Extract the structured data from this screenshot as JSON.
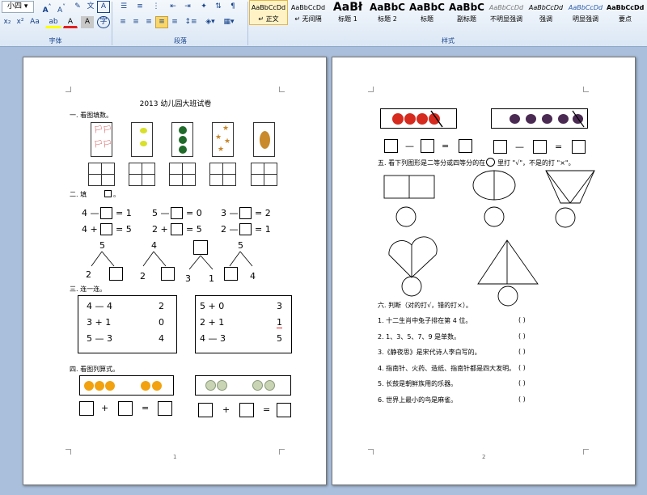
{
  "ribbon": {
    "font_size": "小四",
    "group_font": "字体",
    "group_paragraph": "段落",
    "group_styles": "样式",
    "btn_bold_like": "A",
    "btn_char_border": "A",
    "btn_char_shade": "A",
    "btn_phonetic": "文",
    "btn_circle": "字",
    "btn_sub": "x₂",
    "btn_sup": "x²",
    "btn_case": "Aa",
    "btn_highlight": "ab",
    "btn_font_color": "A",
    "styles": [
      {
        "sample": "AaBbCcDd",
        "name": "↵ 正文"
      },
      {
        "sample": "AaBbCcDd",
        "name": "↵ 无间隔"
      },
      {
        "sample": "AaBł",
        "name": "标题 1"
      },
      {
        "sample": "AaBbC",
        "name": "标题 2"
      },
      {
        "sample": "AaBbC",
        "name": "标题"
      },
      {
        "sample": "AaBbC",
        "name": "副标题"
      },
      {
        "sample": "AaBbCcDd",
        "name": "不明显强调"
      },
      {
        "sample": "AaBbCcDd",
        "name": "强调"
      },
      {
        "sample": "AaBbCcDd",
        "name": "明显强调"
      },
      {
        "sample": "AaBbCcDd",
        "name": "要点"
      }
    ]
  },
  "page1": {
    "title": "2013 幼儿园大班试卷",
    "q1": "一.   看图填数。",
    "q2a": "二.   填",
    "q2b": "。",
    "eq_row1": [
      "4 —",
      "= 1",
      "5 —",
      "= 0",
      "3 —",
      "= 2"
    ],
    "eq_row2": [
      "4 +",
      "= 5",
      "2 +",
      "= 5",
      "2 —",
      "= 1"
    ],
    "tree_tops": [
      "5",
      "4",
      "",
      "5"
    ],
    "tree_left": [
      "2",
      "2",
      "3",
      ""
    ],
    "tree_right": [
      "",
      "",
      "1",
      "4"
    ],
    "q3": "三.   连一连。",
    "match_left": [
      [
        "4 — 4",
        "3 + 1",
        "5 — 3"
      ],
      [
        "5 + 0",
        "2 + 1",
        "4 — 3"
      ]
    ],
    "match_right": [
      [
        "2",
        "0",
        "4"
      ],
      [
        "3",
        "1",
        "5"
      ]
    ],
    "q4": "四.    看图列算式。",
    "plus": "+",
    "equals": "=",
    "page_number": "1"
  },
  "page2": {
    "minus": "—",
    "equals": "=",
    "q5a": "五.  看下列图形是二等分或四等分的在",
    "q5b": "里打 \"√\"，不是的打 \"×\"。",
    "q6": "六.  判断（对的打√，错的打×）。",
    "judge_items": [
      "1. 十二生肖中兔子排在第 4 位。",
      "2. 1、3、5、7、9 是单数。",
      "3.《静夜思》是宋代诗人李白写的。",
      "4. 指南针、火药、造纸、指南针都是四大发明。",
      "5. 长鼓是朝鲜族用的乐器。",
      "6. 世界上最小的鸟是麻雀。"
    ],
    "paren": "(          )",
    "page_number": "2"
  },
  "colors": {
    "apple": "#d62a1e",
    "orange": "#f2a20e",
    "grape": "#4a2a52",
    "green_ball": "#1f6b2a",
    "lemon": "#d9e02a"
  }
}
